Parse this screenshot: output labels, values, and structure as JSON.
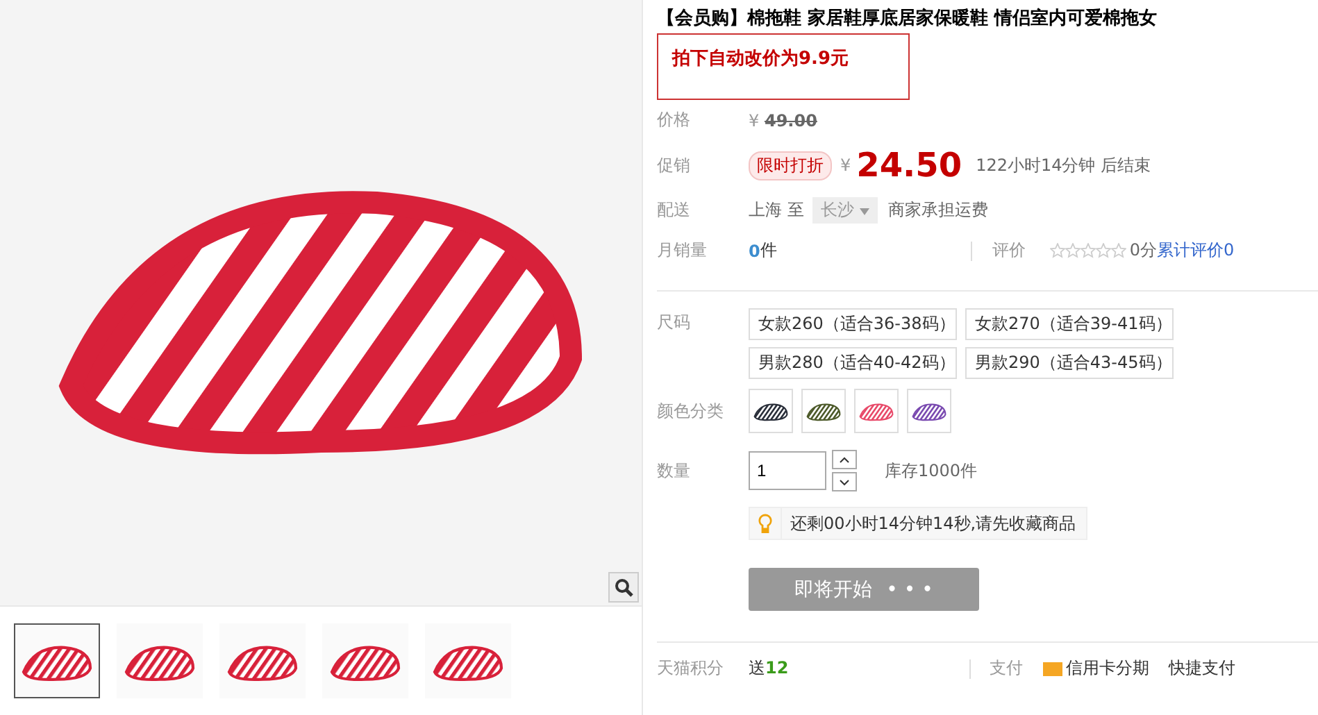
{
  "product_title": "【会员购】棉拖鞋 家居鞋厚底居家保暖鞋 情侣室内可爱棉拖女",
  "notice": "拍下自动改价为9.9元",
  "price": {
    "label": "价格",
    "currency": "¥",
    "value": "49.00"
  },
  "promo": {
    "label": "促销",
    "badge": "限时打折",
    "currency": "¥",
    "value": "24.50",
    "countdown": "122小时14分钟 后结束"
  },
  "delivery": {
    "label": "配送",
    "from": "上海",
    "to_word": "至",
    "destination": "长沙",
    "shipping": "商家承担运费"
  },
  "sales": {
    "label": "月销量",
    "count": "0",
    "unit": "件",
    "rating_label": "评价",
    "stars": 0,
    "score": "0分",
    "reviews_link": "累计评价0"
  },
  "sizes": {
    "label": "尺码",
    "options": [
      {
        "text": "女款260（适合36-38码）",
        "selected": false
      },
      {
        "text": "女款270（适合39-41码）",
        "selected": false
      },
      {
        "text": "男款280（适合40-42码）",
        "selected": false
      },
      {
        "text": "男款290（适合43-45码）",
        "selected": false
      }
    ]
  },
  "colors": {
    "label": "颜色分类",
    "swatches": [
      {
        "color": "#2a2f3a",
        "selected": false
      },
      {
        "color": "#4d5a2a",
        "selected": false
      },
      {
        "color": "#e84a6a",
        "selected": false
      },
      {
        "color": "#7a4ab0",
        "selected": false
      }
    ]
  },
  "quantity": {
    "label": "数量",
    "value": "1",
    "stock": "库存1000件"
  },
  "tip": "还剩00小时14分钟14秒,请先收藏商品",
  "buy_button": {
    "label": "即将开始",
    "dots": "• • •",
    "disabled": true
  },
  "footer": {
    "points_label": "天猫积分",
    "points_prefix": "送",
    "points": "12",
    "pay_label": "支付",
    "credit": "信用卡分期",
    "quick_pay": "快捷支付"
  },
  "thumbnails": [
    {
      "selected": true
    },
    {
      "selected": false
    },
    {
      "selected": false
    },
    {
      "selected": false
    },
    {
      "selected": false
    }
  ]
}
